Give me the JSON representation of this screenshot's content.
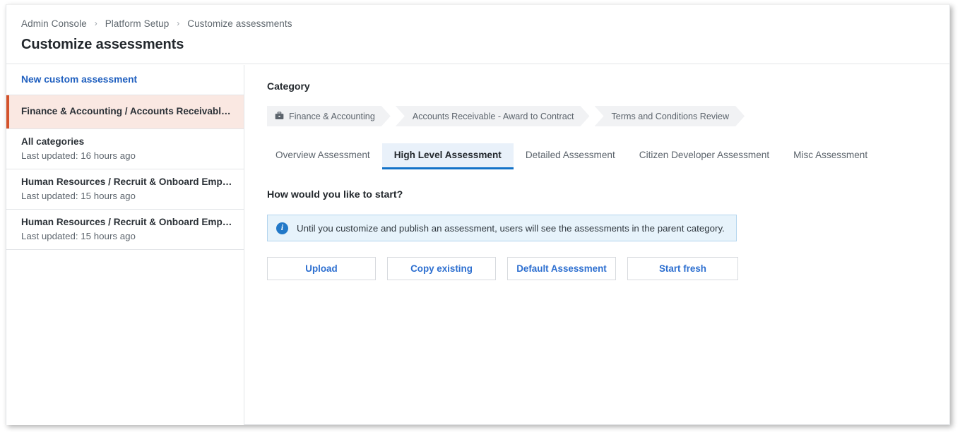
{
  "header": {
    "breadcrumb": [
      "Admin Console",
      "Platform Setup",
      "Customize assessments"
    ],
    "separator": "›",
    "page_title": "Customize assessments"
  },
  "sidebar": {
    "new_assessment_label": "New custom assessment",
    "items": [
      {
        "title": "Finance & Accounting / Accounts Receivable - A…",
        "subtitle": "",
        "selected": true
      },
      {
        "title": "All categories",
        "subtitle": "Last updated: 16 hours ago",
        "selected": false
      },
      {
        "title": "Human Resources / Recruit & Onboard Employ…",
        "subtitle": "Last updated: 15 hours ago",
        "selected": false
      },
      {
        "title": "Human Resources / Recruit & Onboard Employ…",
        "subtitle": "Last updated: 15 hours ago",
        "selected": false
      }
    ]
  },
  "main": {
    "category_label": "Category",
    "chevrons": [
      {
        "label": "Finance & Accounting",
        "icon": "briefcase-icon"
      },
      {
        "label": "Accounts Receivable - Award to Contract",
        "icon": ""
      },
      {
        "label": "Terms and Conditions Review",
        "icon": ""
      }
    ],
    "tabs": [
      {
        "label": "Overview Assessment",
        "active": false
      },
      {
        "label": "High Level Assessment",
        "active": true
      },
      {
        "label": "Detailed Assessment",
        "active": false
      },
      {
        "label": "Citizen Developer Assessment",
        "active": false
      },
      {
        "label": "Misc Assessment",
        "active": false
      }
    ],
    "question": "How would you like to start?",
    "banner": {
      "icon": "info-icon",
      "icon_glyph": "i",
      "text": "Until you customize and publish an assessment, users will see the assessments in the parent category."
    },
    "actions": [
      {
        "label": "Upload"
      },
      {
        "label": "Copy existing"
      },
      {
        "label": "Default Assessment"
      },
      {
        "label": "Start fresh"
      }
    ]
  },
  "colors": {
    "accent_blue": "#1272c8",
    "link_blue": "#2d6fd0",
    "selected_bar": "#d4522b",
    "selected_bg": "#fae8e2",
    "banner_bg": "#e7f3fb",
    "tab_active_bg": "#e9f1fa"
  }
}
